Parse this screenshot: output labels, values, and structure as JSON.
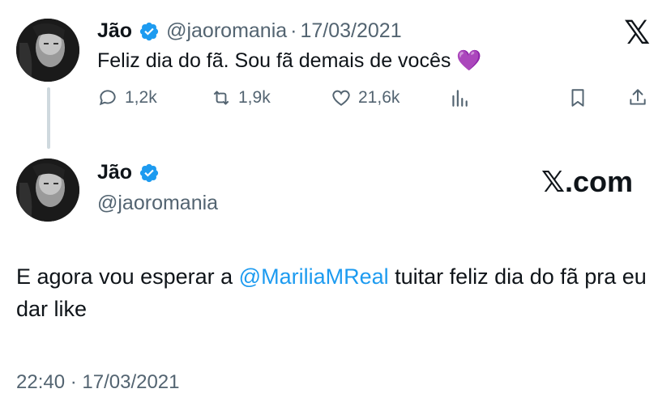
{
  "tweet1": {
    "name": "Jão",
    "handle": "@jaoromania",
    "separator": "·",
    "date": "17/03/2021",
    "text": "Feliz dia do fã. Sou fã demais de vocês",
    "emoji": "💜",
    "actions": {
      "replies": "1,2k",
      "retweets": "1,9k",
      "likes": "21,6k"
    },
    "logo": "𝕏"
  },
  "tweet2": {
    "name": "Jão",
    "handle": "@jaoromania",
    "brand": "𝕏.com",
    "text_before": "E agora vou esperar a ",
    "mention": "@MariliaMReal",
    "text_after": " tuitar feliz dia do fã pra eu dar like",
    "timestamp": "22:40 · 17/03/2021"
  },
  "colors": {
    "accent": "#1d9bf0",
    "muted": "#536471",
    "text": "#0f1419",
    "verified": "#1d9bf0"
  },
  "icons": [
    "verified-badge-icon",
    "reply-icon",
    "retweet-icon",
    "like-icon",
    "views-icon",
    "bookmark-icon",
    "share-icon",
    "x-logo-icon"
  ]
}
